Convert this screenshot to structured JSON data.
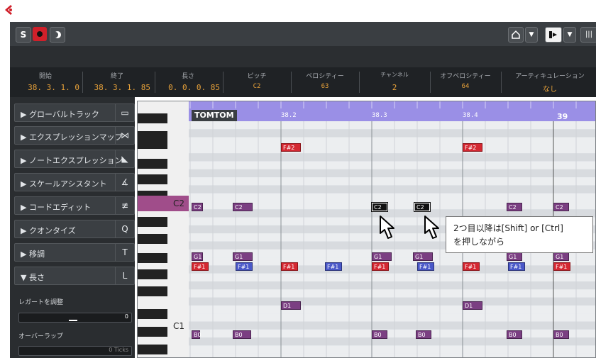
{
  "toolbar": {
    "solo_label": "S",
    "buttons": [
      "solo-button",
      "record-button",
      "moon-button"
    ]
  },
  "info_line": [
    {
      "label": "開始",
      "value": "38. 3. 1.  0"
    },
    {
      "label": "終了",
      "value": "38. 3. 1. 85"
    },
    {
      "label": "長さ",
      "value": "0. 0. 0. 85"
    },
    {
      "label": "ピッチ",
      "value": "C2"
    },
    {
      "label": "ベロシティー",
      "value": "63"
    },
    {
      "label": "チャンネル",
      "value": "2"
    },
    {
      "label": "オフベロシティー",
      "value": "64"
    },
    {
      "label": "アーティキュレーション",
      "value": "なし"
    }
  ],
  "inspector": {
    "items": [
      {
        "label": "▶ グローバルトラック",
        "icon": "▭"
      },
      {
        "label": "▶ エクスプレッションマップ",
        "icon": "⋈"
      },
      {
        "label": "▶ ノートエクスプレッション",
        "icon": "◣"
      },
      {
        "label": "▶ スケールアシスタント",
        "icon": "∡"
      },
      {
        "label": "▶ コードエディット",
        "icon": "≢"
      },
      {
        "label": "▶ クオンタイズ",
        "icon": "Q"
      },
      {
        "label": "▶ 移調",
        "icon": "T"
      },
      {
        "label": "▼ 長さ",
        "icon": "L"
      }
    ],
    "legato_label": "レガートを調整",
    "legato_value": "0",
    "overlap_label": "オーバーラップ",
    "overlap_value": "0 Ticks"
  },
  "editor": {
    "part_name": "TOMTOM",
    "ruler_labels": [
      "38.2",
      "38.3",
      "38.4"
    ],
    "bar_label": "39",
    "key_labels": [
      "C2",
      "C1"
    ],
    "notes": {
      "fs2": "F#2",
      "c2": "C2",
      "g1": "G1",
      "fs1": "F#1",
      "d1": "D1",
      "b0": "B0"
    }
  },
  "annotation": {
    "line1": "2つ目以降は[Shift] or [Ctrl]",
    "line2": "を押しながら"
  },
  "colors": {
    "accent_orange": "#e8a23a",
    "ruler_purple": "#9a8fe6",
    "note_purple": "#7b3f82",
    "note_red": "#d42832",
    "note_blue": "#4a58c8",
    "record_red": "#d0202a"
  }
}
